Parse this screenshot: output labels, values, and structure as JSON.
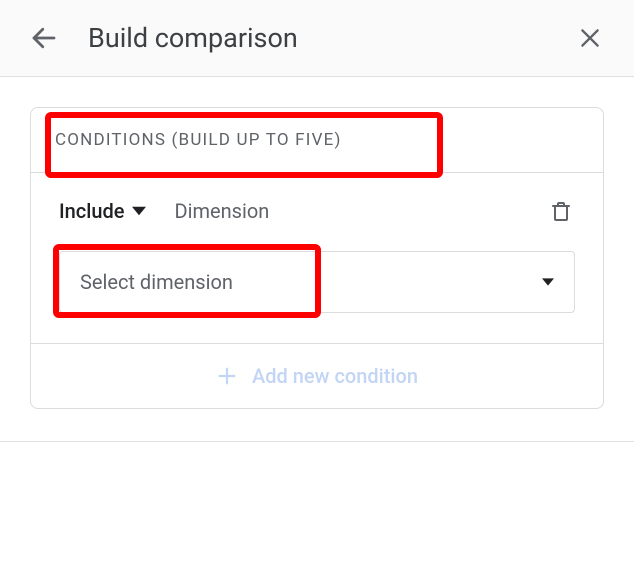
{
  "header": {
    "title": "Build comparison"
  },
  "card": {
    "section_label": "CONDITIONS (BUILD UP TO FIVE)"
  },
  "condition": {
    "mode_label": "Include",
    "type_label": "Dimension",
    "select_placeholder": "Select dimension"
  },
  "footer": {
    "add_label": "Add new condition"
  }
}
